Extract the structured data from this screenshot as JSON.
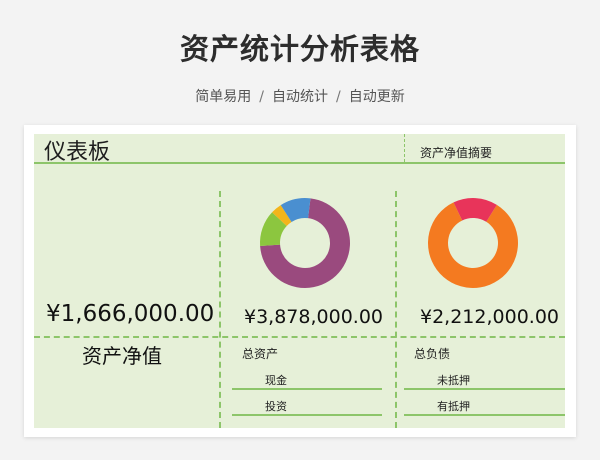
{
  "header": {
    "title": "资产统计分析表格",
    "tags": [
      "简单易用",
      "自动统计",
      "自动更新"
    ],
    "separator": "/"
  },
  "dashboard": {
    "title": "仪表板",
    "summary_label": "资产净值摘要",
    "net_worth": {
      "amount": "¥1,666,000.00",
      "label": "资产净值"
    },
    "total_assets": {
      "amount": "¥3,878,000.00",
      "label": "总资产",
      "items": [
        "现金",
        "投资"
      ]
    },
    "total_liabilities": {
      "amount": "¥2,212,000.00",
      "label": "总负债",
      "items": [
        "未抵押",
        "有抵押"
      ]
    }
  },
  "colors": {
    "sheet_bg": "#e6f0d8",
    "grid_green": "#8dc56a",
    "asset_donut": [
      "#9a4a7e",
      "#8cc63f",
      "#f3b51b",
      "#4a8fd0"
    ],
    "liability_donut": [
      "#f47a20",
      "#e8345a"
    ]
  },
  "chart_data": [
    {
      "type": "pie",
      "name": "",
      "categories": [
        "",
        "",
        "",
        ""
      ],
      "values": [
        72,
        13,
        4,
        11
      ],
      "donut": true
    },
    {
      "type": "pie",
      "name": "",
      "categories": [
        "",
        ""
      ],
      "values": [
        84,
        16
      ],
      "donut": true
    }
  ]
}
